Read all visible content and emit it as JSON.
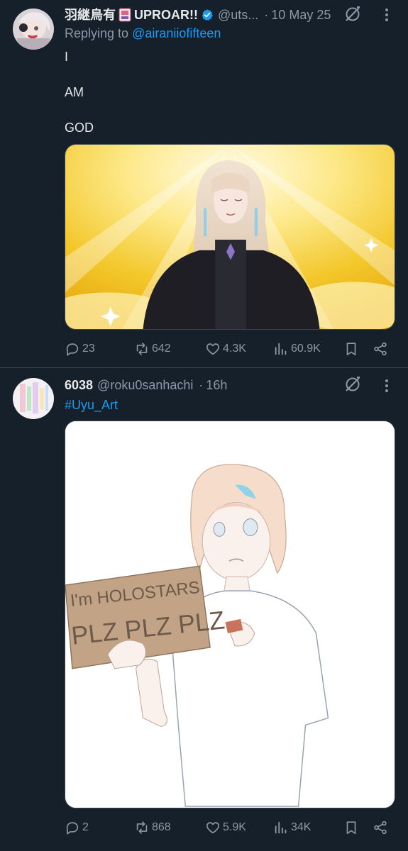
{
  "tweets": [
    {
      "display_name": "羽継烏有",
      "display_name_suffix": "UPROAR!!",
      "handle": "@uts...",
      "separator": "·",
      "time": "10 May 25",
      "replying_prefix": "Replying to ",
      "replying_to": "@airaniiofifteen",
      "text_lines": [
        "I",
        "",
        "AM",
        "",
        "GOD"
      ],
      "stats": {
        "replies": "23",
        "reposts": "642",
        "likes": "4.3K",
        "views": "60.9K"
      },
      "verified": true,
      "icons": [
        "avatar",
        "card-badge-icon",
        "verified-icon",
        "grok-icon",
        "more-icon",
        "reply-icon",
        "repost-icon",
        "like-icon",
        "views-icon",
        "bookmark-icon",
        "share-icon"
      ]
    },
    {
      "display_name": "6038",
      "handle": "@roku0sanhachi",
      "separator": "·",
      "time": "16h",
      "hashtag": "#Uyu_Art",
      "stats": {
        "replies": "2",
        "reposts": "868",
        "likes": "5.9K",
        "views": "34K"
      },
      "verified": false,
      "icons": [
        "avatar",
        "grok-icon",
        "more-icon",
        "reply-icon",
        "repost-icon",
        "like-icon",
        "views-icon",
        "bookmark-icon",
        "share-icon"
      ]
    }
  ],
  "media_2_sign_text": {
    "line1": "I'm HOLOSTARS",
    "line2": "PLZ PLZ PLZ"
  },
  "colors": {
    "background": "#15202b",
    "text_primary": "#e7e9ea",
    "text_secondary": "#8b98a5",
    "link": "#1d9bf0",
    "divider": "#38444d"
  }
}
